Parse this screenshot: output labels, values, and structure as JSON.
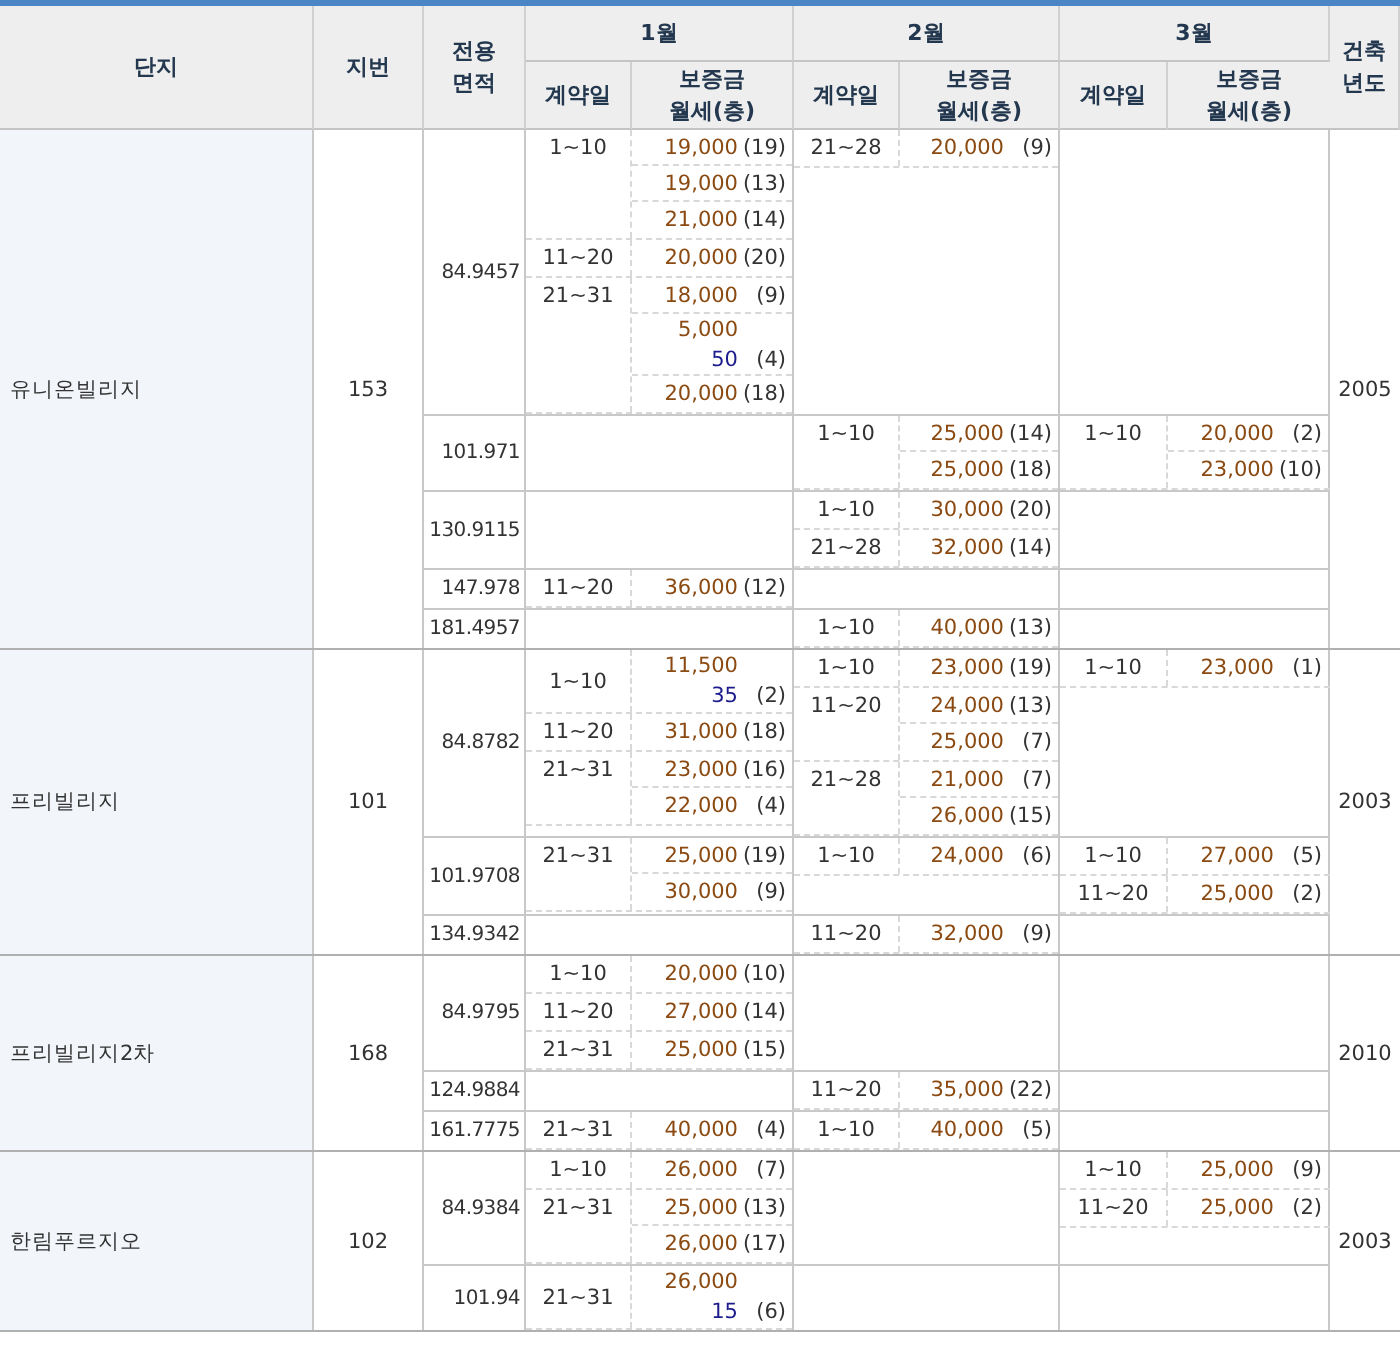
{
  "headers": {
    "complex": "단지",
    "lot_number": "지번",
    "area": "전용면적",
    "build_year": "건축년도"
  },
  "months": [
    {
      "name": "1월",
      "date_header": "계약일",
      "price_header": [
        "보증금",
        "월세(층)"
      ]
    },
    {
      "name": "2월",
      "date_header": "계약일",
      "price_header": [
        "보증금",
        "월세(층)"
      ]
    },
    {
      "name": "3월",
      "date_header": "계약일",
      "price_header": [
        "보증금",
        "월세(층)"
      ]
    }
  ],
  "complexes": [
    {
      "name": "유니온빌리지",
      "lot_number": "153",
      "build_year": "2005",
      "areas": [
        {
          "area": "84.9457",
          "month_1": [
            {
              "date": "1~10",
              "entries": [
                {
                  "deposit": "19,000",
                  "floor": "(19)"
                },
                {
                  "deposit": "19,000",
                  "floor": "(13)"
                },
                {
                  "deposit": "21,000",
                  "floor": "(14)"
                }
              ]
            },
            {
              "date": "11~20",
              "entries": [
                {
                  "deposit": "20,000",
                  "floor": "(20)"
                }
              ]
            },
            {
              "date": "21~31",
              "entries": [
                {
                  "deposit": "18,000",
                  "floor": "(9)"
                },
                {
                  "deposit": "5,000",
                  "rent": "50",
                  "floor": "(4)"
                },
                {
                  "deposit": "20,000",
                  "floor": "(18)"
                }
              ]
            }
          ],
          "month_2": [
            {
              "date": "21~28",
              "entries": [
                {
                  "deposit": "20,000",
                  "floor": "(9)"
                }
              ]
            }
          ]
        },
        {
          "area": "101.971",
          "month_2": [
            {
              "date": "1~10",
              "entries": [
                {
                  "deposit": "25,000",
                  "floor": "(14)"
                },
                {
                  "deposit": "25,000",
                  "floor": "(18)"
                }
              ]
            }
          ],
          "month_3": [
            {
              "date": "1~10",
              "entries": [
                {
                  "deposit": "20,000",
                  "floor": "(2)"
                },
                {
                  "deposit": "23,000",
                  "floor": "(10)"
                }
              ]
            }
          ]
        },
        {
          "area": "130.9115",
          "month_2": [
            {
              "date": "1~10",
              "entries": [
                {
                  "deposit": "30,000",
                  "floor": "(20)"
                }
              ]
            },
            {
              "date": "21~28",
              "entries": [
                {
                  "deposit": "32,000",
                  "floor": "(14)"
                }
              ]
            }
          ]
        },
        {
          "area": "147.978",
          "month_1": [
            {
              "date": "11~20",
              "entries": [
                {
                  "deposit": "36,000",
                  "floor": "(12)"
                }
              ]
            }
          ]
        },
        {
          "area": "181.4957",
          "month_2": [
            {
              "date": "1~10",
              "entries": [
                {
                  "deposit": "40,000",
                  "floor": "(13)"
                }
              ]
            }
          ]
        }
      ]
    },
    {
      "name": "프리빌리지",
      "lot_number": "101",
      "build_year": "2003",
      "areas": [
        {
          "area": "84.8782",
          "month_1": [
            {
              "date": "1~10",
              "entries": [
                {
                  "deposit": "11,500",
                  "rent": "35",
                  "floor": "(2)"
                }
              ]
            },
            {
              "date": "11~20",
              "entries": [
                {
                  "deposit": "31,000",
                  "floor": "(18)"
                }
              ]
            },
            {
              "date": "21~31",
              "entries": [
                {
                  "deposit": "23,000",
                  "floor": "(16)"
                },
                {
                  "deposit": "22,000",
                  "floor": "(4)"
                }
              ]
            }
          ],
          "month_2": [
            {
              "date": "1~10",
              "entries": [
                {
                  "deposit": "23,000",
                  "floor": "(19)"
                }
              ]
            },
            {
              "date": "11~20",
              "entries": [
                {
                  "deposit": "24,000",
                  "floor": "(13)"
                },
                {
                  "deposit": "25,000",
                  "floor": "(7)"
                }
              ]
            },
            {
              "date": "21~28",
              "entries": [
                {
                  "deposit": "21,000",
                  "floor": "(7)"
                },
                {
                  "deposit": "26,000",
                  "floor": "(15)"
                }
              ]
            }
          ],
          "month_3": [
            {
              "date": "1~10",
              "entries": [
                {
                  "deposit": "23,000",
                  "floor": "(1)"
                }
              ]
            }
          ]
        },
        {
          "area": "101.9708",
          "month_1": [
            {
              "date": "21~31",
              "entries": [
                {
                  "deposit": "25,000",
                  "floor": "(19)"
                },
                {
                  "deposit": "30,000",
                  "floor": "(9)"
                }
              ]
            }
          ],
          "month_2": [
            {
              "date": "1~10",
              "entries": [
                {
                  "deposit": "24,000",
                  "floor": "(6)"
                }
              ]
            }
          ],
          "month_3": [
            {
              "date": "1~10",
              "entries": [
                {
                  "deposit": "27,000",
                  "floor": "(5)"
                }
              ]
            },
            {
              "date": "11~20",
              "entries": [
                {
                  "deposit": "25,000",
                  "floor": "(2)"
                }
              ]
            }
          ]
        },
        {
          "area": "134.9342",
          "month_2": [
            {
              "date": "11~20",
              "entries": [
                {
                  "deposit": "32,000",
                  "floor": "(9)"
                }
              ]
            }
          ]
        }
      ]
    },
    {
      "name": "프리빌리지2차",
      "lot_number": "168",
      "build_year": "2010",
      "areas": [
        {
          "area": "84.9795",
          "month_1": [
            {
              "date": "1~10",
              "entries": [
                {
                  "deposit": "20,000",
                  "floor": "(10)"
                }
              ]
            },
            {
              "date": "11~20",
              "entries": [
                {
                  "deposit": "27,000",
                  "floor": "(14)"
                }
              ]
            },
            {
              "date": "21~31",
              "entries": [
                {
                  "deposit": "25,000",
                  "floor": "(15)"
                }
              ]
            }
          ]
        },
        {
          "area": "124.9884",
          "month_2": [
            {
              "date": "11~20",
              "entries": [
                {
                  "deposit": "35,000",
                  "floor": "(22)"
                }
              ]
            }
          ]
        },
        {
          "area": "161.7775",
          "month_1": [
            {
              "date": "21~31",
              "entries": [
                {
                  "deposit": "40,000",
                  "floor": "(4)"
                }
              ]
            }
          ],
          "month_2": [
            {
              "date": "1~10",
              "entries": [
                {
                  "deposit": "40,000",
                  "floor": "(5)"
                }
              ]
            }
          ]
        }
      ]
    },
    {
      "name": "한림푸르지오",
      "lot_number": "102",
      "build_year": "2003",
      "areas": [
        {
          "area": "84.9384",
          "month_1": [
            {
              "date": "1~10",
              "entries": [
                {
                  "deposit": "26,000",
                  "floor": "(7)"
                }
              ]
            },
            {
              "date": "21~31",
              "entries": [
                {
                  "deposit": "25,000",
                  "floor": "(13)"
                },
                {
                  "deposit": "26,000",
                  "floor": "(17)"
                }
              ]
            }
          ],
          "month_3": [
            {
              "date": "1~10",
              "entries": [
                {
                  "deposit": "25,000",
                  "floor": "(9)"
                }
              ]
            },
            {
              "date": "11~20",
              "entries": [
                {
                  "deposit": "25,000",
                  "floor": "(2)"
                }
              ]
            }
          ]
        },
        {
          "area": "101.94",
          "month_1": [
            {
              "date": "21~31",
              "entries": [
                {
                  "deposit": "26,000",
                  "rent": "15",
                  "floor": "(6)"
                }
              ]
            }
          ]
        }
      ]
    }
  ]
}
